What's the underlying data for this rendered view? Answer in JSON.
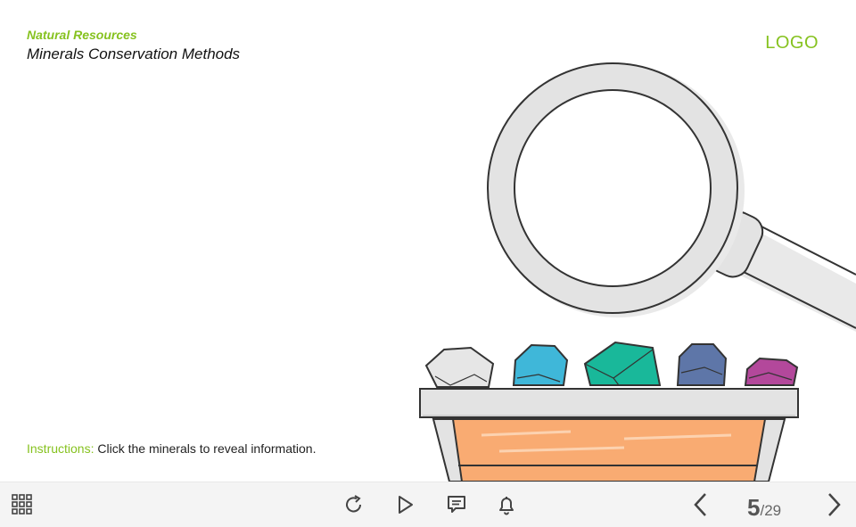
{
  "header": {
    "course": "Natural Resources",
    "title": "Minerals Conservation Methods",
    "logo": "LOGO"
  },
  "instructions": {
    "label": "Instructions:",
    "text": " Click the minerals to reveal information."
  },
  "scene": {
    "minerals": [
      {
        "name": "white-mineral",
        "color": "#e6e6e6"
      },
      {
        "name": "blue-mineral",
        "color": "#3fb7d9"
      },
      {
        "name": "green-mineral",
        "color": "#19b89a"
      },
      {
        "name": "navy-mineral",
        "color": "#5e76a8"
      },
      {
        "name": "magenta-mineral",
        "color": "#b3489b"
      }
    ],
    "colors": {
      "accent": "#86c21f",
      "planter": "#f9ab72",
      "frame": "#e3e3e3"
    }
  },
  "bottombar": {
    "icons": [
      "menu-grid-icon",
      "replay-icon",
      "play-icon",
      "comment-icon",
      "bell-icon",
      "prev-icon",
      "next-icon"
    ],
    "page_current": "5",
    "page_sep": "/",
    "page_total": "29"
  }
}
